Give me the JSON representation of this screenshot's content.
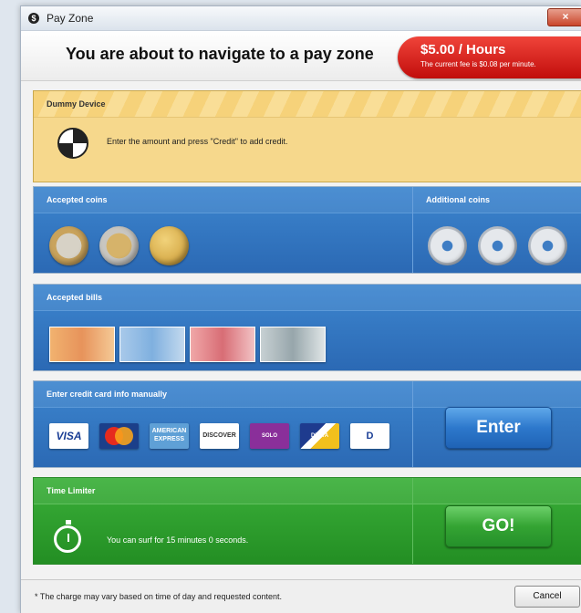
{
  "window": {
    "title": "Pay Zone",
    "app_icon": "$",
    "close_icon": "×"
  },
  "header": {
    "heading": "You are about to navigate to a pay zone",
    "fee_rate": "$5.00 / Hours",
    "fee_note": "The current fee is $0.08 per minute."
  },
  "device": {
    "title": "Dummy Device",
    "message": "Enter the amount and press \"Credit\" to add credit."
  },
  "coins": {
    "accepted_label": "Accepted coins",
    "additional_label": "Additional coins",
    "accepted": [
      "2 euro coin",
      "1 euro coin",
      "50 cent coin"
    ],
    "additional": [
      "token coin",
      "token coin",
      "token coin"
    ]
  },
  "bills": {
    "label": "Accepted bills",
    "items": [
      "50 euro note",
      "20 euro note",
      "10 euro note",
      "5 euro note"
    ]
  },
  "card": {
    "label": "Enter credit card info manually",
    "logos": {
      "visa": "VISA",
      "amex": "AMERICAN EXPRESS",
      "discover": "DISCOVER",
      "solo": "SOLO",
      "delta": "DELTA",
      "diners": "D"
    },
    "enter_button": "Enter"
  },
  "timer": {
    "label": "Time Limiter",
    "message": "You can surf for 15 minutes 0 seconds.",
    "go_button": "GO!"
  },
  "footer": {
    "note": "* The charge may vary based on time of day and requested content.",
    "cancel_button": "Cancel"
  },
  "colors": {
    "fee_badge": "#d81e1a",
    "device_panel": "#f6d88c",
    "blue_panel": "#3479c2",
    "green_panel": "#2e9f2d"
  }
}
